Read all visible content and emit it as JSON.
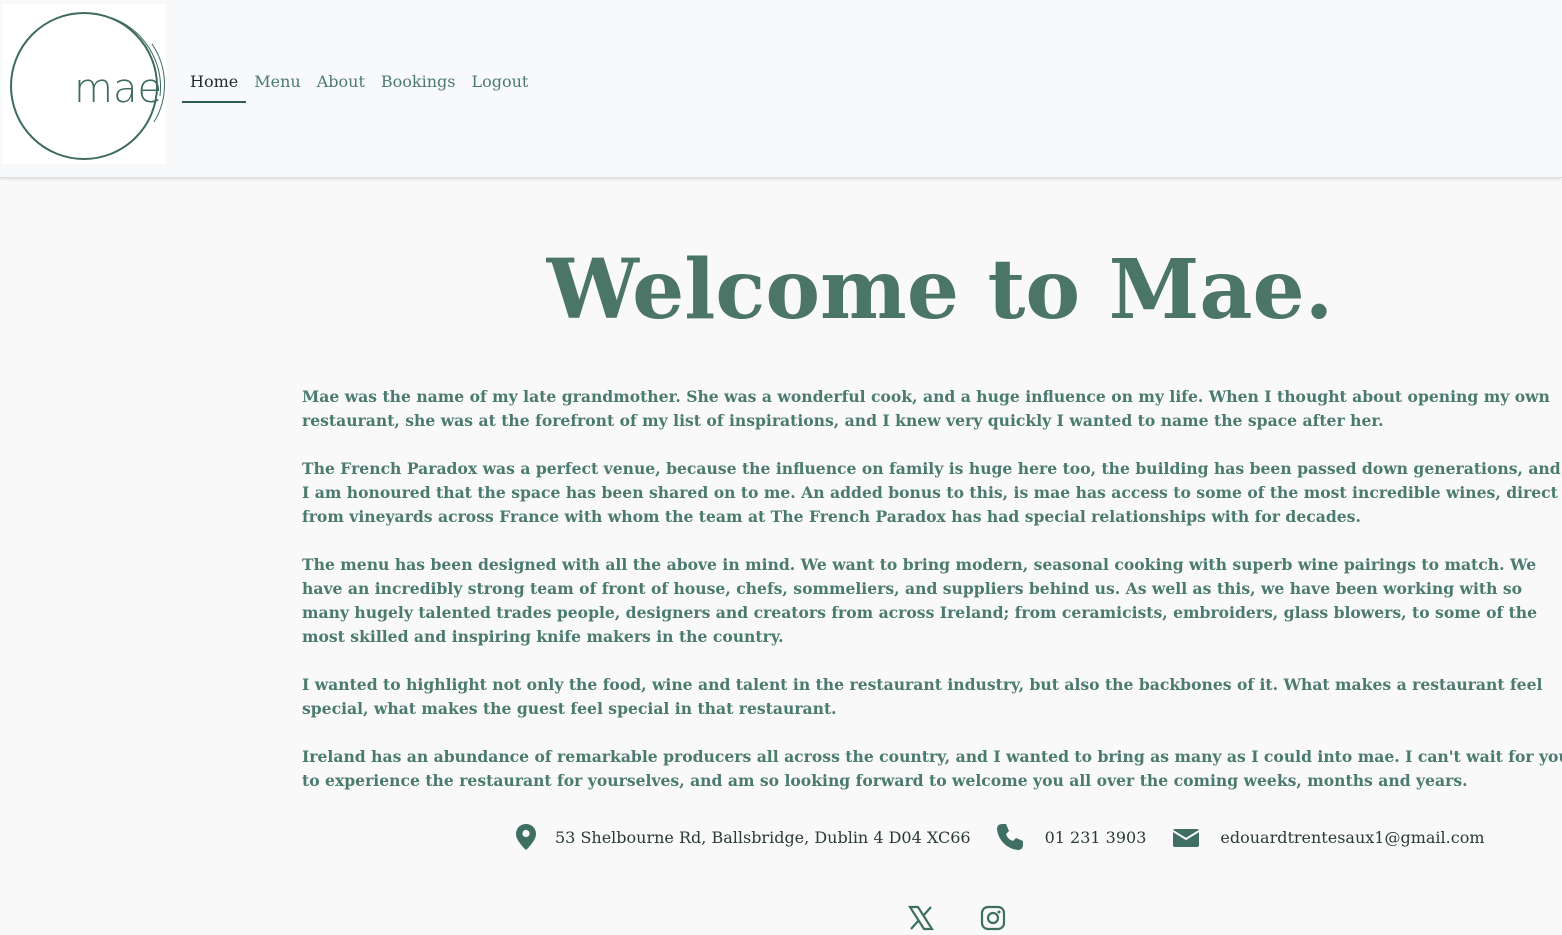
{
  "nav": {
    "logo_text": "mae",
    "links": [
      {
        "label": "Home",
        "active": true
      },
      {
        "label": "Menu"
      },
      {
        "label": "About"
      },
      {
        "label": "Bookings"
      },
      {
        "label": "Logout"
      }
    ]
  },
  "hero": {
    "title": "Welcome to Mae."
  },
  "intro": {
    "paragraphs": [
      "Mae was the name of my late grandmother. She was a wonderful cook, and a huge influence on my life. When I thought about opening my own restaurant, she was at the forefront of my list of inspirations, and I knew very quickly I wanted to name the space after her.",
      "The French Paradox was a perfect venue, because the influence on family is huge here too, the building has been passed down generations, and I am honoured that the space has been shared on to me. An added bonus to this, is mae has access to some of the most incredible wines, direct from vineyards across France with whom the team at The French Paradox has had special relationships with for decades.",
      "The menu has been designed with all the above in mind. We want to bring modern, seasonal cooking with superb wine pairings to match. We have an incredibly strong team of front of house, chefs, sommeliers, and suppliers behind us. As well as this, we have been working with so many hugely talented trades people, designers and creators from across Ireland; from ceramicists, embroiders, glass blowers, to some of the most skilled and inspiring knife makers in the country.",
      "I wanted to highlight not only the food, wine and talent in the restaurant industry, but also the backbones of it. What makes a restaurant feel special, what makes the guest feel special in that restaurant.",
      "Ireland has an abundance of remarkable producers all across the country, and I wanted to bring as many as I could into mae. I can't wait for you to experience the restaurant for yourselves, and am so looking forward to welcome you all over the coming weeks, months and years."
    ]
  },
  "contact": {
    "address": "53 Shelbourne Rd, Ballsbridge, Dublin 4 D04 XC66",
    "phone": "01 231 3903",
    "email": "edouardtrentesaux1@gmail.com",
    "icons": [
      "location-pin-icon",
      "phone-icon",
      "envelope-icon"
    ]
  },
  "social": {
    "icons": [
      "x-twitter-icon",
      "instagram-icon"
    ]
  },
  "colors": {
    "brand_green": "#4b7567",
    "text_green": "#4b7a6e",
    "background": "#f8f9f8"
  }
}
